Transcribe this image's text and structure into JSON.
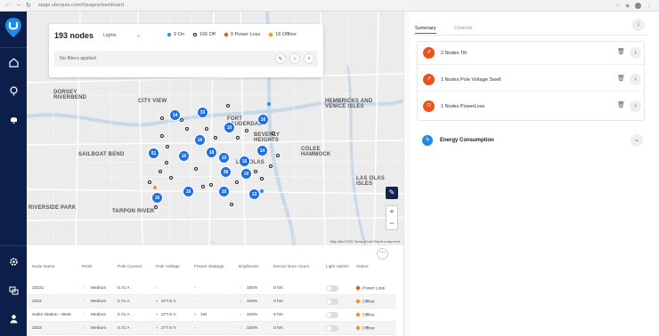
{
  "browser": {
    "url": "stage.ubicquia.com/#/pages/dashboard"
  },
  "sidebar": {
    "items": [
      "home",
      "location",
      "alerts",
      "settings",
      "devices",
      "user"
    ]
  },
  "filter": {
    "node_count": "193 nodes",
    "type_select": "Lights",
    "legend": [
      {
        "label": "9 On",
        "color": "#1e8be8"
      },
      {
        "label": "166 Off",
        "color": "#222222"
      },
      {
        "label": "9 Power Loss",
        "color": "#e8541e"
      },
      {
        "label": "16 Offline",
        "color": "#e89a1e"
      }
    ],
    "no_filters": "No filters applied"
  },
  "map": {
    "labels": [
      "CITY VIEW",
      "DORSEY RIVERBEND",
      "SAILBOAT BEND",
      "FORT LAUDERDALE",
      "BEVERLY HEIGHTS",
      "LAS OLAS",
      "RIVERSIDE PARK",
      "TARPON RIVER",
      "HEMBRICKS AND VENICE ISLES",
      "COLEE HAMMOCK",
      "LAS OLAS ISLES"
    ],
    "clusters": [
      "14",
      "33",
      "16",
      "10",
      "16",
      "14",
      "51",
      "10",
      "18",
      "10",
      "16",
      "38",
      "10",
      "16",
      "10",
      "13",
      "16"
    ],
    "attribution": "Map data ©2021  Terms of Use  Report a map error"
  },
  "table": {
    "columns": [
      "Node Name",
      "RSSI",
      "Pole Current",
      "Pole Voltage",
      "Fixture Wattage",
      "Brightness",
      "Device Burn Hours",
      "Light Switch",
      "Status"
    ],
    "rows": [
      {
        "name": "33221",
        "rssi": "Medium",
        "current": "0.71 A",
        "voltage": "-",
        "wattage": "-",
        "brightness": "100%",
        "burn": "0 hrs",
        "status": "Power Loss"
      },
      {
        "name": "2322",
        "rssi": "Medium",
        "current": "0.71 A",
        "voltage": "277.5 V",
        "wattage": "-",
        "brightness": "100%",
        "burn": "0 hrs",
        "status": "Offline"
      },
      {
        "name": "Sailor Station - West",
        "rssi": "Medium",
        "current": "0.71 A",
        "voltage": "277.5 V",
        "wattage": "1W",
        "brightness": "100%",
        "burn": "0 hrs",
        "status": "Offline"
      },
      {
        "name": "2323",
        "rssi": "Medium",
        "current": "0.71 A",
        "voltage": "277.5 V",
        "wattage": "-",
        "brightness": "100%",
        "burn": "0 hrs",
        "status": "Offline"
      }
    ]
  },
  "panel": {
    "tabs": [
      "Summary",
      "Controls"
    ],
    "alerts": [
      "2 Nodes Tilt",
      "1 Nodes Pole Voltage Swell",
      "1 Nodes PowerLoss"
    ],
    "energy_label": "Energy Consumption"
  }
}
